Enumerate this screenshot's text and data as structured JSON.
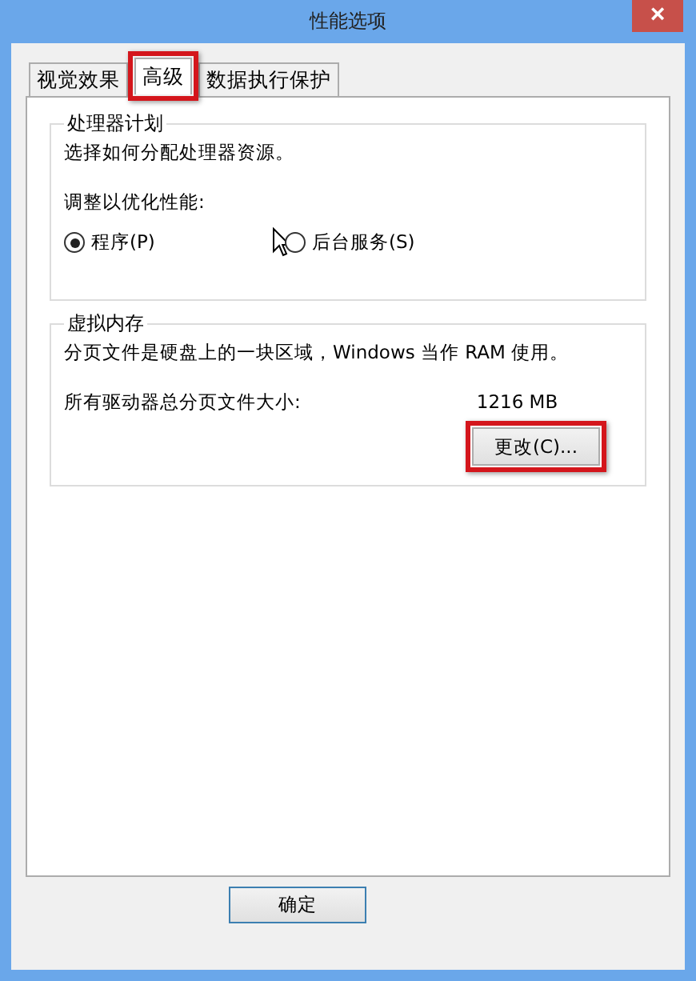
{
  "window": {
    "title": "性能选项",
    "close": "×"
  },
  "tabs": [
    {
      "label": "视觉效果",
      "selected": false,
      "highlighted": false
    },
    {
      "label": "高级",
      "selected": true,
      "highlighted": true
    },
    {
      "label": "数据执行保护",
      "selected": false,
      "highlighted": false
    }
  ],
  "processor_group": {
    "title": "处理器计划",
    "description": "选择如何分配处理器资源。",
    "prompt": "调整以优化性能:",
    "options": [
      {
        "label": "程序(P)",
        "selected": true
      },
      {
        "label": "后台服务(S)",
        "selected": false
      }
    ]
  },
  "virtual_memory_group": {
    "title": "虚拟内存",
    "description": "分页文件是硬盘上的一块区域，Windows 当作 RAM 使用。",
    "size_label": "所有驱动器总分页文件大小:",
    "size_value": "1216 MB",
    "button": {
      "label": "更改(C)...",
      "highlighted": true
    }
  },
  "buttons": [
    "确定"
  ]
}
